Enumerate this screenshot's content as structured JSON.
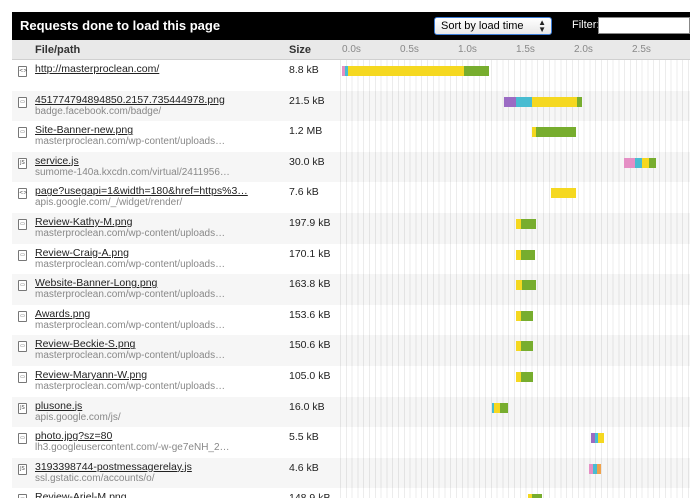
{
  "window": {
    "title": "Requests done to load this page",
    "sort": "Sort by load time",
    "filter_label": "Filter:",
    "filter_value": ""
  },
  "columns": {
    "file": "File/path",
    "size": "Size"
  },
  "ticks": [
    "0.0s",
    "0.5s",
    "1.0s",
    "1.5s",
    "2.0s",
    "2.5s"
  ],
  "colors": {
    "dns": "#e58fc5",
    "connect": "#48bcd1",
    "ssl": "#9b6bc4",
    "wait": "#f5d820",
    "receive": "#77ad2e",
    "blocked": "#f0a24a"
  },
  "requests": [
    {
      "icon": "html-file-icon",
      "icon_text": "<>",
      "name": "http://masterproclean.com/",
      "domain": "",
      "size": "8.8 kB",
      "timing": [
        [
          "dns",
          0.0,
          0.03
        ],
        [
          "connect",
          0.03,
          0.05
        ],
        [
          "wait",
          0.05,
          1.05
        ],
        [
          "receive",
          1.05,
          1.27
        ]
      ]
    },
    {
      "icon": "image-file-icon",
      "icon_text": "▭",
      "name": "451774794894850.2157.735444978.png",
      "domain": "badge.facebook.com/badge/",
      "size": "21.5 kB",
      "timing": [
        [
          "ssl",
          1.4,
          1.5
        ],
        [
          "connect",
          1.5,
          1.64
        ],
        [
          "wait",
          1.64,
          2.03
        ],
        [
          "receive",
          2.03,
          2.07
        ]
      ]
    },
    {
      "icon": "image-file-icon",
      "icon_text": "▭",
      "name": "Site-Banner-new.png",
      "domain": "masterproclean.com/wp-content/uploads…",
      "size": "1.2 MB",
      "timing": [
        [
          "wait",
          1.64,
          1.67
        ],
        [
          "receive",
          1.67,
          2.02
        ]
      ]
    },
    {
      "icon": "script-file-icon",
      "icon_text": "JS",
      "name": "service.js",
      "domain": "sumome-140a.kxcdn.com/virtual/2411956…",
      "size": "30.0 kB",
      "timing": [
        [
          "dns",
          2.43,
          2.53
        ],
        [
          "connect",
          2.53,
          2.59
        ],
        [
          "wait",
          2.59,
          2.65
        ],
        [
          "receive",
          2.65,
          2.71
        ]
      ]
    },
    {
      "icon": "html-file-icon",
      "icon_text": "<>",
      "name": "page?usegapi=1&width=180&href=https%3…",
      "domain": "apis.google.com/_/widget/render/",
      "size": "7.6 kB",
      "timing": [
        [
          "wait",
          1.8,
          2.02
        ]
      ]
    },
    {
      "icon": "image-file-icon",
      "icon_text": "▭",
      "name": "Review-Kathy-M.png",
      "domain": "masterproclean.com/wp-content/uploads…",
      "size": "197.9 kB",
      "timing": [
        [
          "wait",
          1.5,
          1.54
        ],
        [
          "receive",
          1.54,
          1.67
        ]
      ]
    },
    {
      "icon": "image-file-icon",
      "icon_text": "▭",
      "name": "Review-Craig-A.png",
      "domain": "masterproclean.com/wp-content/uploads…",
      "size": "170.1 kB",
      "timing": [
        [
          "wait",
          1.5,
          1.54
        ],
        [
          "receive",
          1.54,
          1.66
        ]
      ]
    },
    {
      "icon": "image-file-icon",
      "icon_text": "▭",
      "name": "Website-Banner-Long.png",
      "domain": "masterproclean.com/wp-content/uploads…",
      "size": "163.8 kB",
      "timing": [
        [
          "wait",
          1.5,
          1.55
        ],
        [
          "receive",
          1.55,
          1.67
        ]
      ]
    },
    {
      "icon": "image-file-icon",
      "icon_text": "▭",
      "name": "Awards.png",
      "domain": "masterproclean.com/wp-content/uploads…",
      "size": "153.6 kB",
      "timing": [
        [
          "wait",
          1.5,
          1.54
        ],
        [
          "receive",
          1.54,
          1.65
        ]
      ]
    },
    {
      "icon": "image-file-icon",
      "icon_text": "▭",
      "name": "Review-Beckie-S.png",
      "domain": "masterproclean.com/wp-content/uploads…",
      "size": "150.6 kB",
      "timing": [
        [
          "wait",
          1.5,
          1.54
        ],
        [
          "receive",
          1.54,
          1.65
        ]
      ]
    },
    {
      "icon": "image-file-icon",
      "icon_text": "▭",
      "name": "Review-Maryann-W.png",
      "domain": "masterproclean.com/wp-content/uploads…",
      "size": "105.0 kB",
      "timing": [
        [
          "wait",
          1.5,
          1.54
        ],
        [
          "receive",
          1.54,
          1.65
        ]
      ]
    },
    {
      "icon": "script-file-icon",
      "icon_text": "JS",
      "name": "plusone.js",
      "domain": "apis.google.com/js/",
      "size": "16.0 kB",
      "timing": [
        [
          "connect",
          1.29,
          1.31
        ],
        [
          "wait",
          1.31,
          1.36
        ],
        [
          "receive",
          1.36,
          1.43
        ]
      ]
    },
    {
      "icon": "image-file-icon",
      "icon_text": "▭",
      "name": "photo.jpg?sz=80",
      "domain": "lh3.googleusercontent.com/-w-ge7eNH_2…",
      "size": "5.5 kB",
      "timing": [
        [
          "ssl",
          2.15,
          2.18
        ],
        [
          "connect",
          2.18,
          2.21
        ],
        [
          "wait",
          2.21,
          2.26
        ]
      ]
    },
    {
      "icon": "script-file-icon",
      "icon_text": "JS",
      "name": "3193398744-postmessagerelay.js",
      "domain": "ssl.gstatic.com/accounts/o/",
      "size": "4.6 kB",
      "timing": [
        [
          "dns",
          2.13,
          2.16
        ],
        [
          "connect",
          2.16,
          2.2
        ],
        [
          "blocked",
          2.2,
          2.23
        ]
      ]
    },
    {
      "icon": "image-file-icon",
      "icon_text": "▭",
      "name": "Review-Ariel-M.png",
      "domain": "",
      "size": "148.9 kB",
      "timing": [
        [
          "wait",
          1.6,
          1.64
        ],
        [
          "receive",
          1.64,
          1.72
        ]
      ]
    }
  ]
}
